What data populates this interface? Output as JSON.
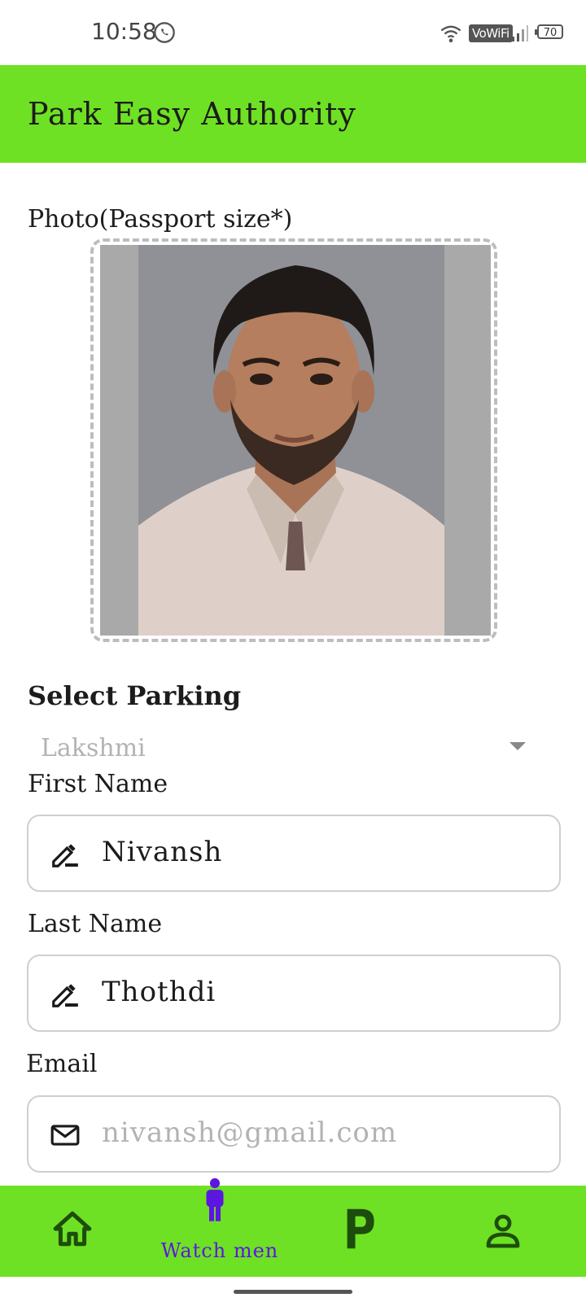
{
  "status_bar": {
    "time": "10:58",
    "vowifi": "VoWiFi",
    "battery": "70"
  },
  "app_bar": {
    "title": "Park Easy Authority"
  },
  "form": {
    "photo_label": "Photo(Passport size*)",
    "parking_label": "Select Parking",
    "parking_value": "Lakshmi",
    "first_name_label": "First Name",
    "first_name_value": "Nivansh",
    "last_name_label": "Last Name",
    "last_name_value": "Thothdi",
    "email_label": "Email",
    "email_placeholder": "nivansh@gmail.com"
  },
  "bottom_nav": {
    "items": [
      {
        "icon": "home-icon",
        "label": ""
      },
      {
        "icon": "person-standing-icon",
        "label": "Watch men",
        "active": true
      },
      {
        "icon": "parking-icon",
        "label": ""
      },
      {
        "icon": "profile-icon",
        "label": ""
      }
    ]
  },
  "colors": {
    "accent_green": "#6ee124",
    "nav_icon": "#1d4d0c",
    "active_label": "#5c16e0"
  }
}
